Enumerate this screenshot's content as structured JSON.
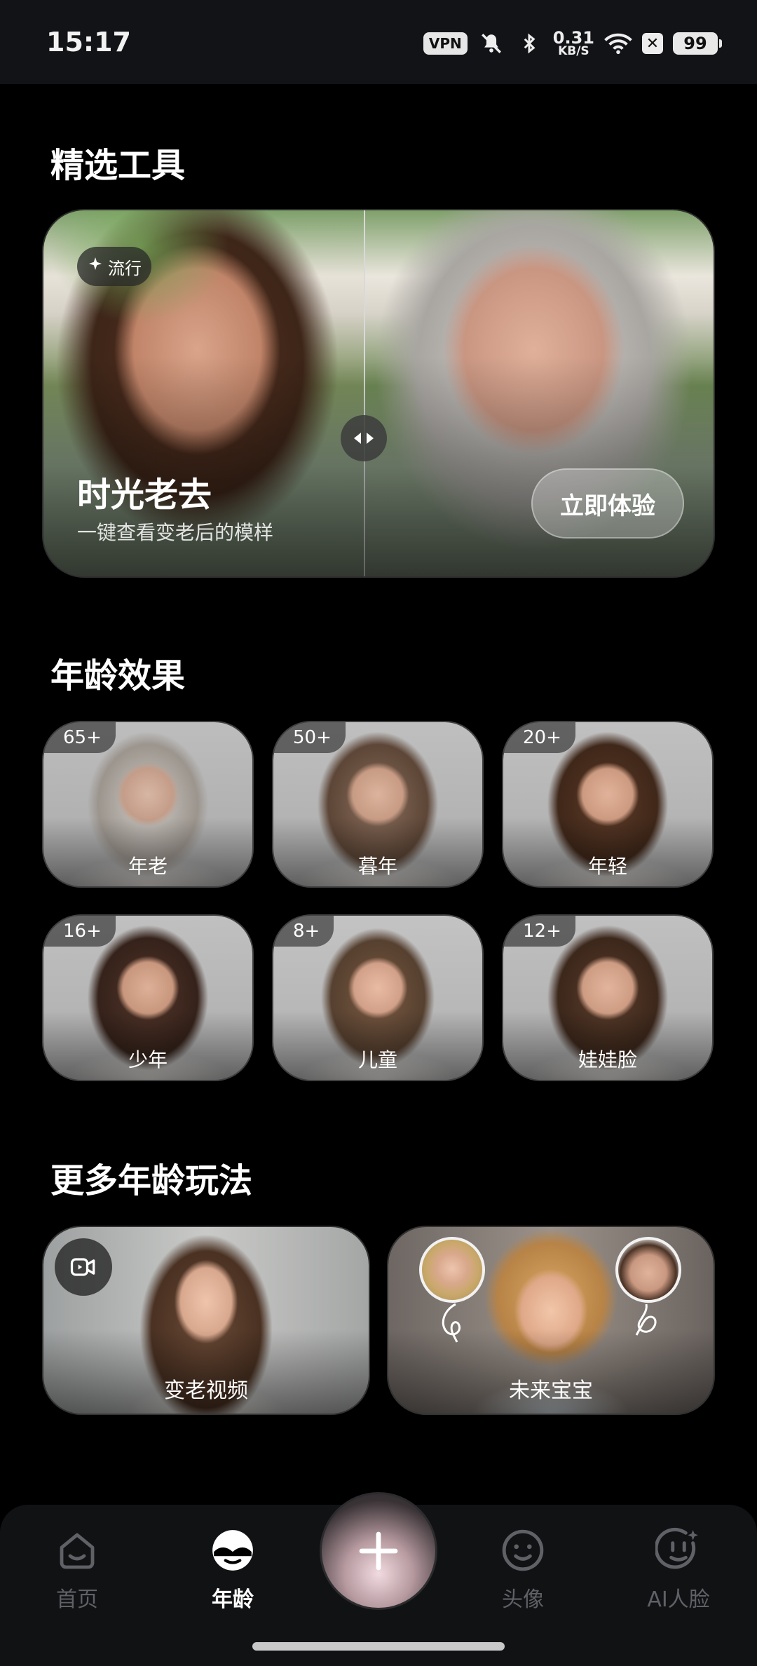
{
  "status_bar": {
    "time": "15:17",
    "vpn": "VPN",
    "net_speed_value": "0.31",
    "net_speed_unit": "KB/S",
    "battery": "99",
    "icons": [
      "mute-bell-icon",
      "bluetooth-icon",
      "wifi-icon",
      "close-box-icon",
      "battery-icon"
    ]
  },
  "featured": {
    "section_title": "精选工具",
    "tag": "流行",
    "title": "时光老去",
    "subtitle": "一键查看变老后的模样",
    "cta": "立即体验"
  },
  "age_effects": {
    "section_title": "年龄效果",
    "items": [
      {
        "badge": "65+",
        "label": "年老"
      },
      {
        "badge": "50+",
        "label": "暮年"
      },
      {
        "badge": "20+",
        "label": "年轻"
      },
      {
        "badge": "16+",
        "label": "少年"
      },
      {
        "badge": "8+",
        "label": "儿童"
      },
      {
        "badge": "12+",
        "label": "娃娃脸"
      }
    ]
  },
  "more": {
    "section_title": "更多年龄玩法",
    "items": [
      {
        "label": "变老视频"
      },
      {
        "label": "未来宝宝"
      }
    ]
  },
  "bottom_nav": {
    "items": [
      {
        "label": "首页",
        "icon": "home-face-icon"
      },
      {
        "label": "年龄",
        "icon": "age-face-icon"
      },
      {
        "label": "头像",
        "icon": "smile-face-icon"
      },
      {
        "label": "AI人脸",
        "icon": "ai-face-icon"
      }
    ],
    "active": "年龄",
    "center_icon": "plus-icon"
  }
}
